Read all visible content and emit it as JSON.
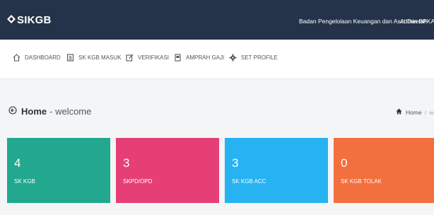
{
  "topbar": {
    "brand": "SIKGB",
    "organization": "Badan Pengelolaan Keuangan dan Aset Daerah",
    "user": "Admin BPKAD"
  },
  "nav": {
    "items": [
      {
        "label": "DASHBOARD",
        "icon": "home-icon"
      },
      {
        "label": "SK KGB MASUK",
        "icon": "document-icon"
      },
      {
        "label": "VERIFIKASI",
        "icon": "edit-icon"
      },
      {
        "label": "AMPRAH GAJI",
        "icon": "file-icon"
      },
      {
        "label": "SET PROFILE",
        "icon": "gear-icon"
      }
    ]
  },
  "page": {
    "title": "Home",
    "subtitle": "- welcome"
  },
  "breadcrumb": {
    "home": "Home",
    "separator": "/",
    "current": "welcome"
  },
  "cards": [
    {
      "value": "4",
      "label": "SK KGB",
      "color": "#21a88e"
    },
    {
      "value": "3",
      "label": "SKPD/OPD",
      "color": "#e63f76"
    },
    {
      "value": "3",
      "label": "SK KGB ACC",
      "color": "#27b2f2"
    },
    {
      "value": "0",
      "label": "SK KGB TOLAK",
      "color": "#f26f3e"
    }
  ],
  "colors": {
    "topbar": "#25334a",
    "background": "#f4f5f6"
  }
}
